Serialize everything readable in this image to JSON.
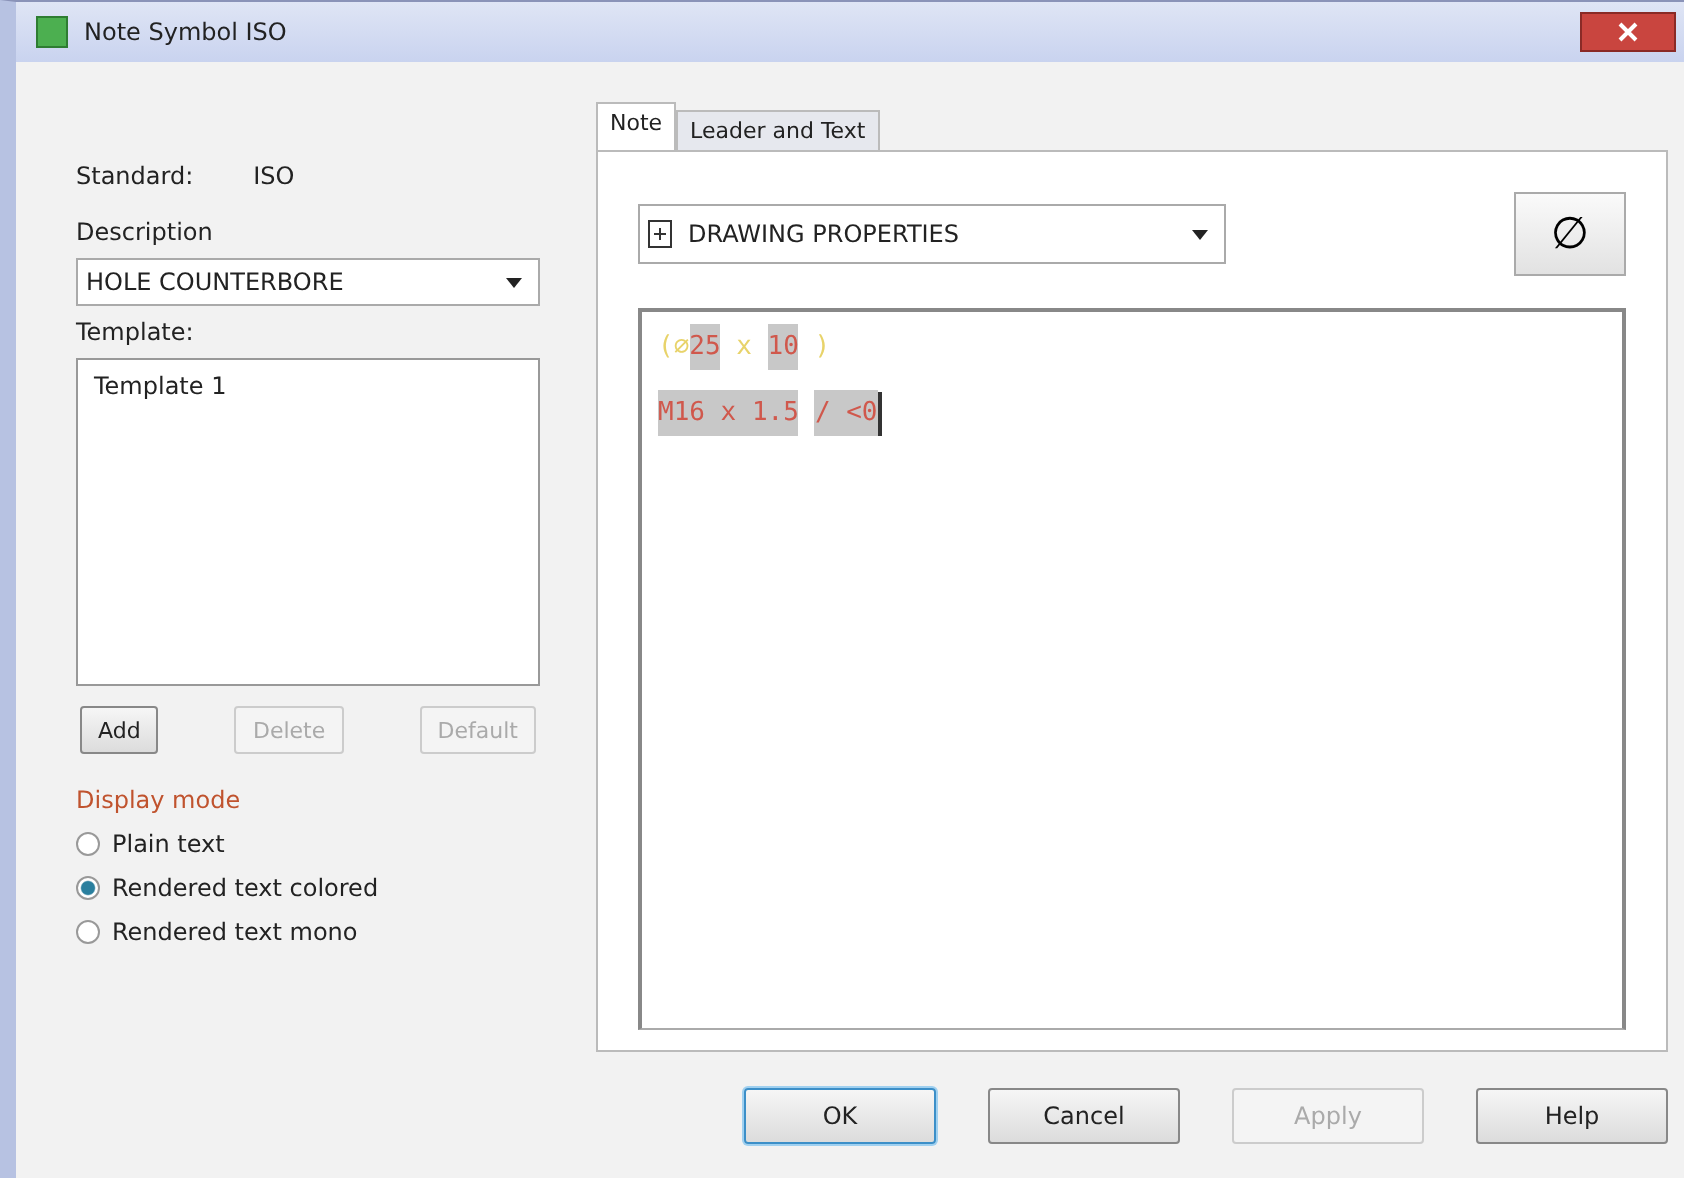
{
  "window": {
    "title": "Note Symbol ISO"
  },
  "standard": {
    "label": "Standard:",
    "value": "ISO"
  },
  "description": {
    "label": "Description",
    "value": "HOLE COUNTERBORE"
  },
  "template": {
    "label": "Template:",
    "items": [
      {
        "label": "Template 1",
        "selected": false
      }
    ]
  },
  "template_buttons": [
    {
      "label": "Add",
      "disabled": false
    },
    {
      "label": "Delete",
      "disabled": true
    },
    {
      "label": "Default",
      "disabled": true
    }
  ],
  "display_mode": {
    "label": "Display mode",
    "options": [
      {
        "label": "Plain text",
        "selected": false
      },
      {
        "label": "Rendered text colored",
        "selected": true
      },
      {
        "label": "Rendered text mono",
        "selected": false
      }
    ]
  },
  "tabs": [
    {
      "label": "Note",
      "selected": true
    },
    {
      "label": "Leader and Text",
      "selected": false
    }
  ],
  "properties_dropdown": {
    "value": "DRAWING PROPERTIES"
  },
  "symbol_button": {
    "label": "∅"
  },
  "note_lines": [
    [
      {
        "kind": "plain",
        "text": "(⌀"
      },
      {
        "kind": "field",
        "text": "25"
      },
      {
        "kind": "plain",
        "text": " x "
      },
      {
        "kind": "field",
        "text": "10"
      },
      {
        "kind": "plain",
        "text": " )"
      }
    ],
    [
      {
        "kind": "field",
        "text": "M16 x 1.5"
      },
      {
        "kind": "field",
        "text": "/ <0"
      }
    ]
  ],
  "buttons": [
    {
      "label": "OK",
      "default": true,
      "disabled": false
    },
    {
      "label": "Cancel",
      "default": false,
      "disabled": false
    },
    {
      "label": "Apply",
      "default": false,
      "disabled": true
    },
    {
      "label": "Help",
      "default": false,
      "disabled": false
    }
  ]
}
